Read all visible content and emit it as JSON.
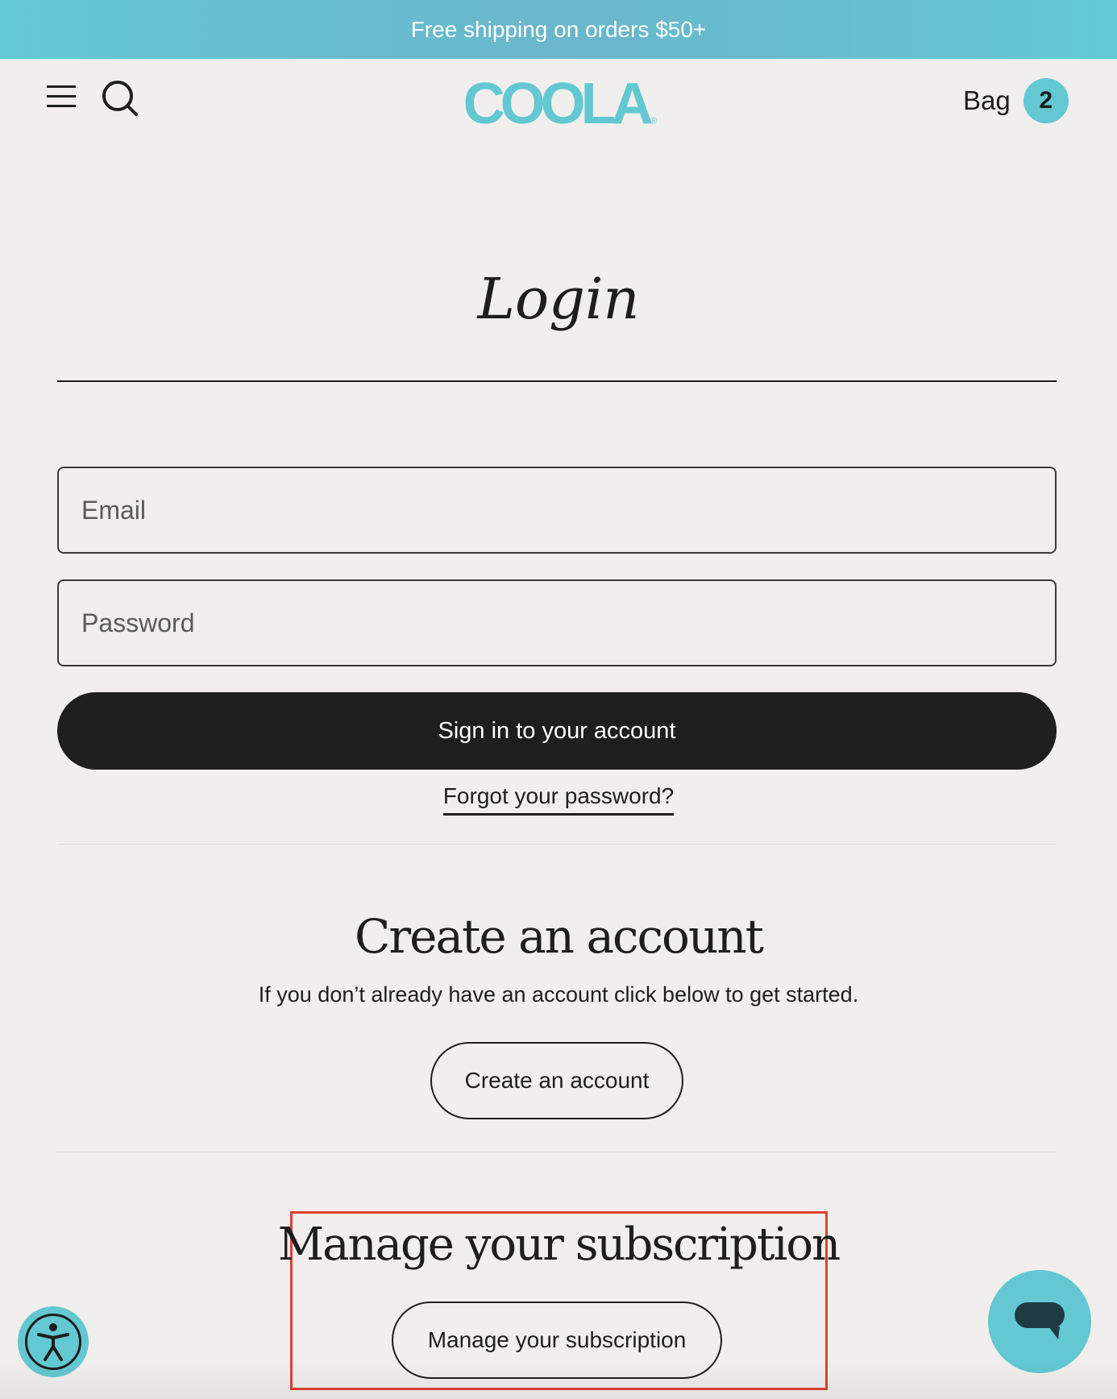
{
  "announcement": {
    "text": "Free shipping on orders $50+"
  },
  "header": {
    "logo_text": "COOLA",
    "logo_mark": "®",
    "bag_label": "Bag",
    "bag_count": "2",
    "menu_icon": "hamburger-menu-icon",
    "search_icon": "search-icon"
  },
  "login": {
    "title": "Login",
    "email_placeholder": "Email",
    "password_placeholder": "Password",
    "signin_label": "Sign in to your account",
    "forgot_label": "Forgot your password?"
  },
  "create_account": {
    "title": "Create an account",
    "description": "If you don’t already have an account click below to get started.",
    "button_label": "Create an account"
  },
  "subscription": {
    "title": "Manage your subscription",
    "button_label": "Manage your subscription"
  },
  "floating": {
    "accessibility_icon": "accessibility-icon",
    "chat_icon": "chat-bubble-icon"
  },
  "colors": {
    "brand": "#63c8d1",
    "background": "#f0efee",
    "primary_button": "#1e1e1e",
    "highlight_border": "#e0402f"
  }
}
